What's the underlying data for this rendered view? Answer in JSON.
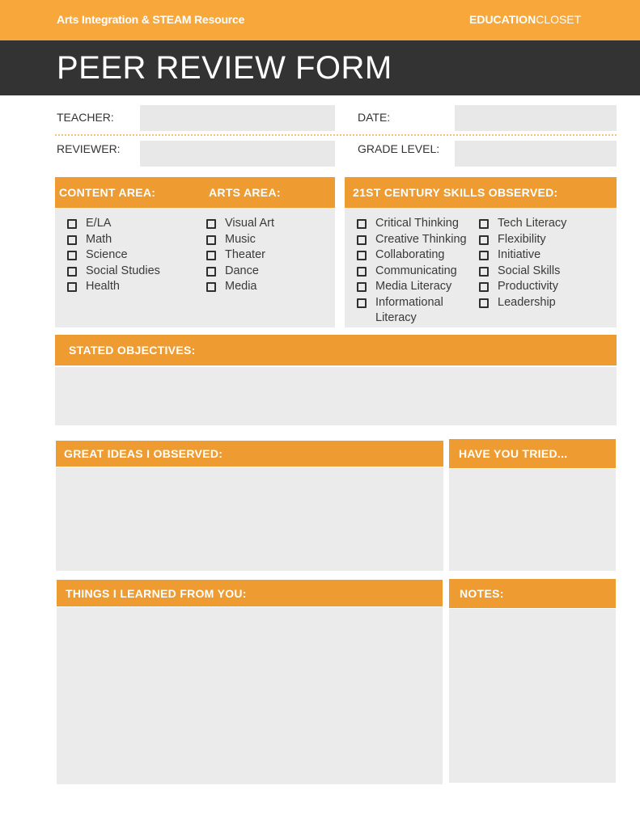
{
  "header": {
    "resource_label": "Arts Integration & STEAM Resource",
    "brand_bold": "EDUCATION",
    "brand_light": "CLOSET",
    "title": "PEER REVIEW FORM"
  },
  "info_fields": {
    "teacher_label": "TEACHER:",
    "teacher_value": "",
    "date_label": "DATE:",
    "date_value": "",
    "reviewer_label": "REVIEWER:",
    "reviewer_value": "",
    "grade_level_label": "GRADE LEVEL:",
    "grade_level_value": ""
  },
  "content_area": {
    "heading": "CONTENT AREA:",
    "items": [
      {
        "label": "E/LA",
        "checked": false
      },
      {
        "label": "Math",
        "checked": false
      },
      {
        "label": "Science",
        "checked": false
      },
      {
        "label": "Social Studies",
        "checked": false
      },
      {
        "label": "Health",
        "checked": false
      }
    ]
  },
  "arts_area": {
    "heading": "ARTS AREA:",
    "items": [
      {
        "label": "Visual Art",
        "checked": false
      },
      {
        "label": "Music",
        "checked": false
      },
      {
        "label": "Theater",
        "checked": false
      },
      {
        "label": "Dance",
        "checked": false
      },
      {
        "label": "Media",
        "checked": false
      }
    ]
  },
  "skills": {
    "heading": "21ST CENTURY SKILLS OBSERVED:",
    "column1": [
      {
        "label": "Critical Thinking",
        "checked": false
      },
      {
        "label": "Creative Thinking",
        "checked": false
      },
      {
        "label": "Collaborating",
        "checked": false
      },
      {
        "label": "Communicating",
        "checked": false
      },
      {
        "label": "Media Literacy",
        "checked": false
      },
      {
        "label": "Informational Literacy",
        "checked": false
      }
    ],
    "column2": [
      {
        "label": "Tech Literacy",
        "checked": false
      },
      {
        "label": "Flexibility",
        "checked": false
      },
      {
        "label": "Initiative",
        "checked": false
      },
      {
        "label": "Social Skills",
        "checked": false
      },
      {
        "label": "Productivity",
        "checked": false
      },
      {
        "label": "Leadership",
        "checked": false
      }
    ]
  },
  "sections": {
    "stated_objectives": {
      "heading": "STATED OBJECTIVES:",
      "value": ""
    },
    "great_ideas": {
      "heading": "GREAT IDEAS I OBSERVED:",
      "value": ""
    },
    "have_you_tried": {
      "heading": "HAVE YOU TRIED...",
      "value": ""
    },
    "things_learned": {
      "heading": "THINGS I LEARNED FROM YOU:",
      "value": ""
    },
    "notes": {
      "heading": "NOTES:",
      "value": ""
    }
  },
  "colors": {
    "accent_orange": "#ee9c32",
    "topbar_orange": "#f8a73a",
    "title_bar": "#333333",
    "field_gray": "#ebebeb"
  }
}
